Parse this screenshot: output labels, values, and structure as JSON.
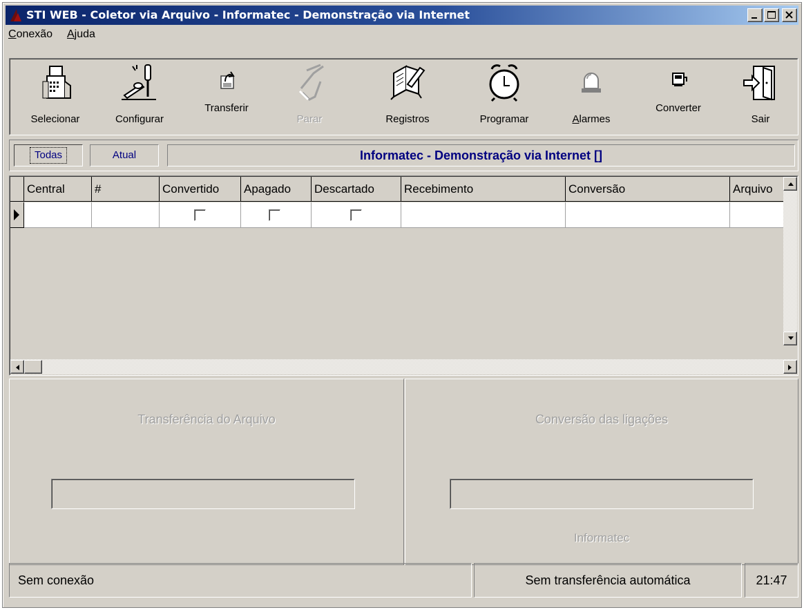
{
  "window": {
    "title": "STI WEB - Coletor via Arquivo - Informatec - Demonstração via Internet",
    "minimize_icon": "minimize-icon",
    "maximize_icon": "maximize-icon",
    "close_icon": "close-icon"
  },
  "menu": [
    {
      "label": "Conexão",
      "accel": "C",
      "rest": "onexão"
    },
    {
      "label": "Ajuda",
      "accel": "A",
      "rest": "juda"
    }
  ],
  "toolbar": [
    {
      "label": "Selecionar",
      "icon": "select-device-icon",
      "enabled": true
    },
    {
      "label": "Configurar",
      "icon": "configure-tools-icon",
      "enabled": true
    },
    {
      "label": "Transferir",
      "icon": "transfer-icon",
      "enabled": true
    },
    {
      "label": "Parar",
      "icon": "stop-hand-icon",
      "enabled": false
    },
    {
      "label": "Registros",
      "icon": "records-book-icon",
      "enabled": true
    },
    {
      "label": "Programar",
      "icon": "alarm-clock-icon",
      "enabled": true
    },
    {
      "label": "Alarmes",
      "icon": "alarm-light-icon",
      "enabled": true
    },
    {
      "label": "Converter",
      "icon": "convert-icon",
      "enabled": true
    },
    {
      "label": "Sair",
      "icon": "exit-door-icon",
      "enabled": true
    }
  ],
  "tabs": {
    "items": [
      "Todas",
      "Atual"
    ],
    "active": "Todas",
    "title": "Informatec - Demonstração via Internet []"
  },
  "grid": {
    "columns": [
      "Central",
      "#",
      "Convertido",
      "Apagado",
      "Descartado",
      "Recebimento",
      "Conversão",
      "Arquivo"
    ],
    "rows": [
      {
        "Central": "",
        "#": "",
        "Convertido": false,
        "Apagado": false,
        "Descartado": false,
        "Recebimento": "",
        "Conversão": "",
        "Arquivo": ""
      }
    ]
  },
  "panels": {
    "transfer": {
      "title": "Transferência do Arquivo"
    },
    "conversion": {
      "title": "Conversão das ligações",
      "footer": "Informatec"
    }
  },
  "statusbar": {
    "connection": "Sem conexão",
    "auto_transfer": "Sem transferência automática",
    "time": "21:47"
  }
}
